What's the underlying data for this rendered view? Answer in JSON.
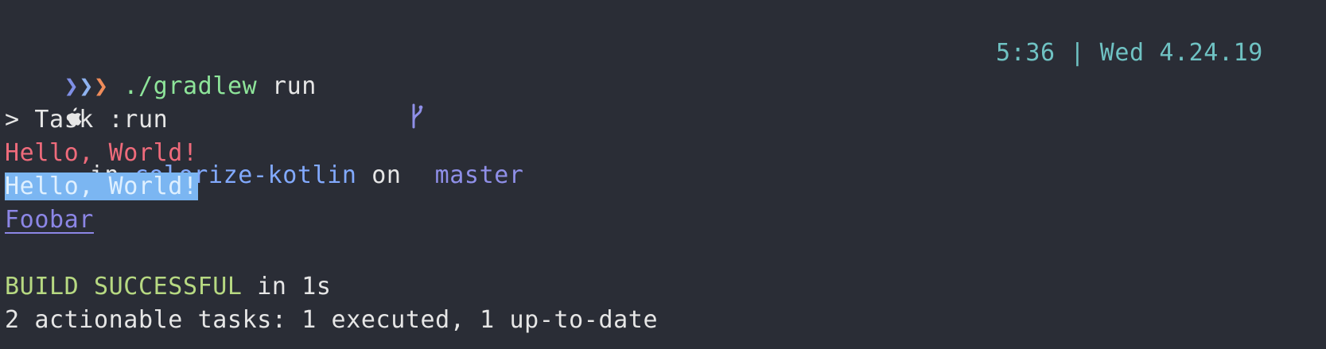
{
  "prompt": {
    "in_label": "in",
    "repo": "colorize-kotlin",
    "on_label": "on",
    "branch": "master"
  },
  "command": {
    "chevrons": [
      "❯",
      "❯",
      "❯"
    ],
    "executable": "./gradlew",
    "args": "run",
    "time": "5:36",
    "separator": "|",
    "date": "Wed 4.24.19"
  },
  "output": {
    "task_line": "> Task :run",
    "hello_red": "Hello, World!",
    "hello_selected": "Hello, World!",
    "foobar": "Foobar",
    "build_status": "BUILD SUCCESSFUL",
    "build_time": " in 1s",
    "tasks_summary": "2 actionable tasks: 1 executed, 1 up-to-date"
  },
  "colors": {
    "background": "#2a2d36",
    "text": "#e6e6e6",
    "repo": "#82aaff",
    "branch": "#8f8fe8",
    "command": "#8ee59a",
    "clock": "#6fc2c3",
    "red_text": "#ef6b7b",
    "selection": "#7bb6f2",
    "link": "#8c86e6",
    "success": "#b7d982"
  },
  "icons": {
    "os": "apple-icon",
    "vcs": "git-branch-icon"
  }
}
